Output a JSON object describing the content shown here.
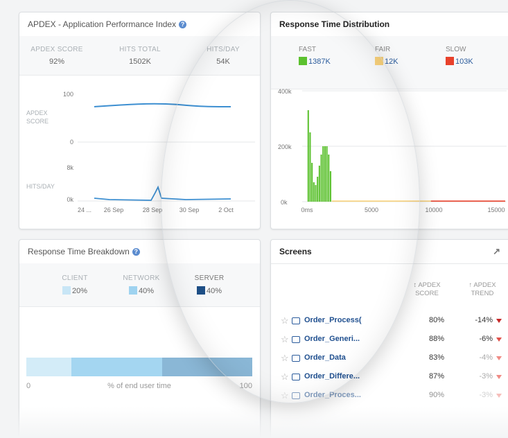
{
  "apdex": {
    "title": "APDEX  - Application Performance Index",
    "stats": [
      {
        "label": "APDEX SCORE",
        "value": "92%"
      },
      {
        "label": "HITS TOTAL",
        "value": "1502K"
      },
      {
        "label": "HITS/DAY",
        "value": "54K"
      }
    ],
    "score_ticks": [
      "100",
      "0"
    ],
    "score_label": [
      "APDEX",
      "SCORE"
    ],
    "hits_ticks": [
      "8k",
      "0k"
    ],
    "hits_label": "HITS/DAY",
    "x_ticks": [
      "24 ...",
      "26 Sep",
      "28 Sep",
      "30 Sep",
      "2 Oct"
    ],
    "line_color": "#3d8fd1"
  },
  "rtd": {
    "title": "Response Time Distribution",
    "legend": [
      {
        "label": "FAST",
        "value": "1387K",
        "color": "#5cc12f"
      },
      {
        "label": "FAIR",
        "value": "12K",
        "color": "#f7d07a"
      },
      {
        "label": "SLOW",
        "value": "103K",
        "color": "#e8412b"
      }
    ],
    "y_ticks": [
      "400k",
      "200k",
      "0k"
    ],
    "x_ticks": [
      "0ms",
      "5000",
      "10000",
      "15000"
    ],
    "chart_data": {
      "type": "bar",
      "series": [
        {
          "name": "FAST",
          "color": "#5cc12f",
          "x": [
            100,
            250,
            400,
            550,
            700,
            850,
            1000,
            1150,
            1300,
            1450,
            1600,
            1750,
            1900,
            2050
          ],
          "values": [
            330,
            250,
            140,
            70,
            60,
            90,
            130,
            170,
            200,
            200,
            200,
            170,
            110,
            0
          ]
        },
        {
          "name": "FAIR",
          "color": "#f7d07a",
          "x_range": [
            2000,
            10000
          ],
          "values": [
            4
          ]
        },
        {
          "name": "SLOW",
          "color": "#e8412b",
          "x_range": [
            10000,
            16000
          ],
          "values": [
            4
          ]
        }
      ],
      "xlim": [
        0,
        16000
      ],
      "ylim": [
        0,
        400
      ]
    }
  },
  "breakdown": {
    "title": "Response Time Breakdown",
    "items": [
      {
        "label": "CLIENT",
        "value": "20%",
        "color": "#c8e6f6"
      },
      {
        "label": "NETWORK",
        "value": "40%",
        "color": "#9fd3f0"
      },
      {
        "label": "SERVER",
        "value": "40%",
        "color": "#1e4f86"
      }
    ],
    "bar_segments": [
      {
        "fraction": 0.2,
        "color": "#d3ecf8"
      },
      {
        "fraction": 0.4,
        "color": "#a4d6f1"
      },
      {
        "fraction": 0.4,
        "color": "#8ab7d6"
      }
    ],
    "axis_min": "0",
    "axis_max": "100",
    "axis_label": "% of end user time"
  },
  "screens": {
    "title": "Screens",
    "col_score": [
      "↕ APDEX",
      "SCORE"
    ],
    "col_trend": [
      "↑ APDEX",
      "TREND"
    ],
    "rows": [
      {
        "name": "Order_Process(",
        "score": "80%",
        "trend": "-14%"
      },
      {
        "name": "Order_Generi...",
        "score": "88%",
        "trend": "-6%"
      },
      {
        "name": "Order_Data",
        "score": "83%",
        "trend": "-4%"
      },
      {
        "name": "Order_Differe...",
        "score": "87%",
        "trend": "-3%"
      },
      {
        "name": "Order_Proces...",
        "score": "90%",
        "trend": "-3%"
      }
    ]
  }
}
